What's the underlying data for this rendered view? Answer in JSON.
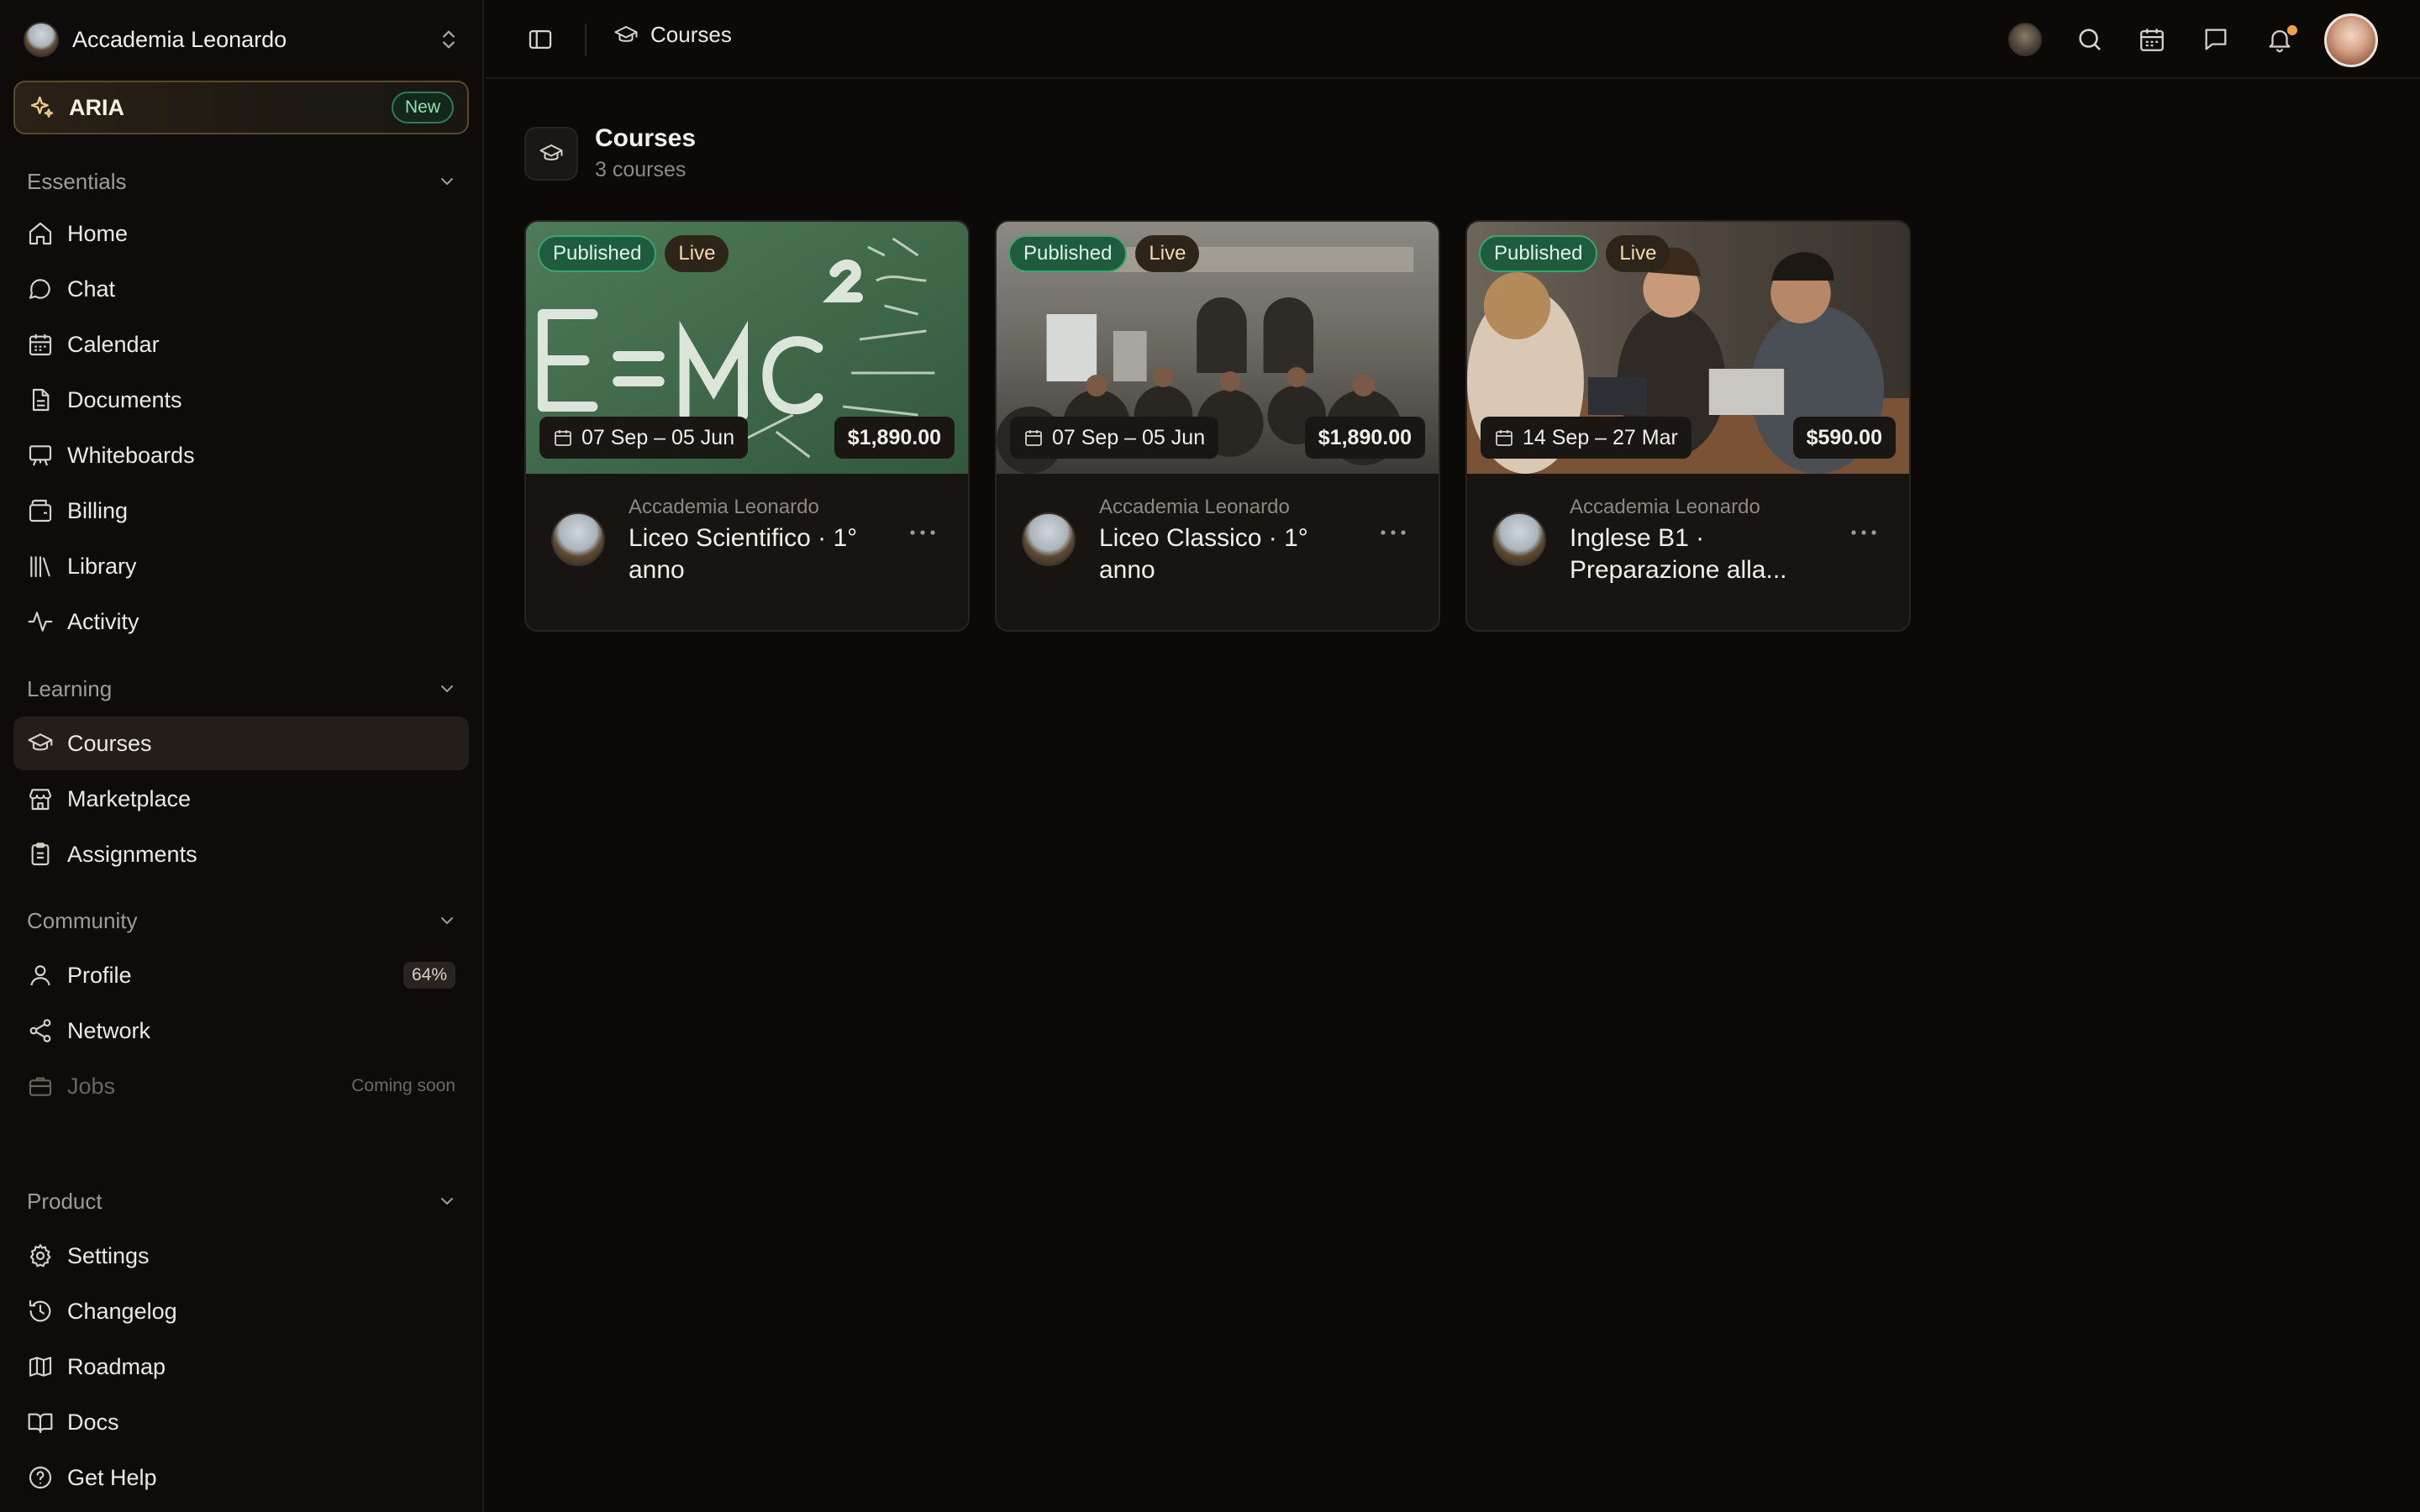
{
  "sidebar": {
    "org_name": "Accademia Leonardo",
    "aria": {
      "label": "ARIA",
      "badge": "New"
    },
    "sections": {
      "essentials": "Essentials",
      "learning": "Learning",
      "community": "Community",
      "product": "Product"
    },
    "items": {
      "home": "Home",
      "chat": "Chat",
      "calendar": "Calendar",
      "documents": "Documents",
      "whiteboards": "Whiteboards",
      "billing": "Billing",
      "library": "Library",
      "activity": "Activity",
      "courses": "Courses",
      "marketplace": "Marketplace",
      "assignments": "Assignments",
      "profile": "Profile",
      "profile_badge": "64%",
      "network": "Network",
      "jobs": "Jobs",
      "jobs_status": "Coming soon",
      "settings": "Settings",
      "changelog": "Changelog",
      "roadmap": "Roadmap",
      "docs": "Docs",
      "get_help": "Get Help"
    }
  },
  "topbar": {
    "breadcrumb": "Courses"
  },
  "main": {
    "title": "Courses",
    "subtitle": "3 courses",
    "courses": [
      {
        "status": "Published",
        "state": "Live",
        "dates": "07 Sep – 05 Jun",
        "price": "$1,890.00",
        "org": "Accademia Leonardo",
        "title": "Liceo Scientifico · 1° anno"
      },
      {
        "status": "Published",
        "state": "Live",
        "dates": "07 Sep – 05 Jun",
        "price": "$1,890.00",
        "org": "Accademia Leonardo",
        "title": "Liceo Classico · 1° anno"
      },
      {
        "status": "Published",
        "state": "Live",
        "dates": "14 Sep – 27 Mar",
        "price": "$590.00",
        "org": "Accademia Leonardo",
        "title": "Inglese B1 · Preparazione alla..."
      }
    ]
  },
  "colors": {
    "accent_green": "#1f5b3e",
    "badge_green": "#8fe2b5",
    "notification": "#f0a24a",
    "background": "#0c0a09"
  }
}
